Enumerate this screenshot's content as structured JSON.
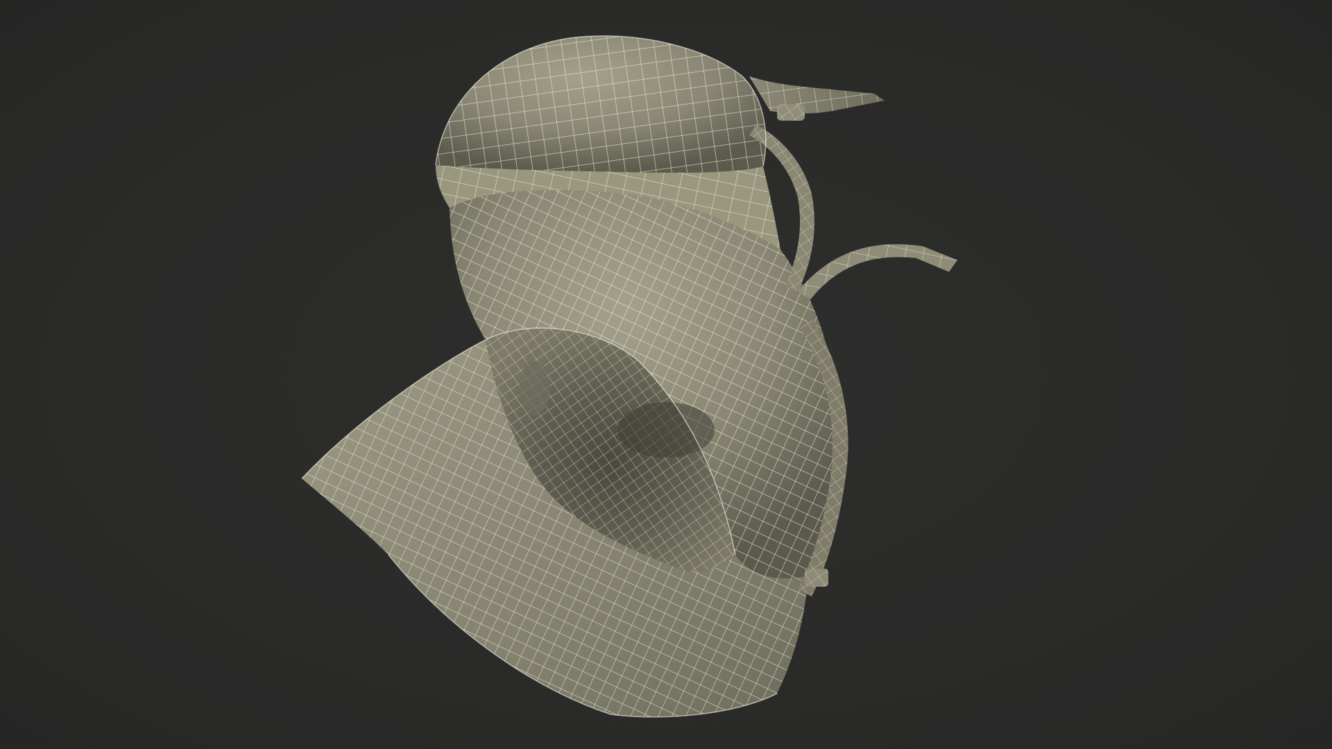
{
  "scene": {
    "background_color": "#2a2a2a",
    "model_color": "#8f8c78",
    "wire_color": "#efeedd",
    "shadow_color": "#3f3e35",
    "subject": "wireframe-helmet-model"
  }
}
